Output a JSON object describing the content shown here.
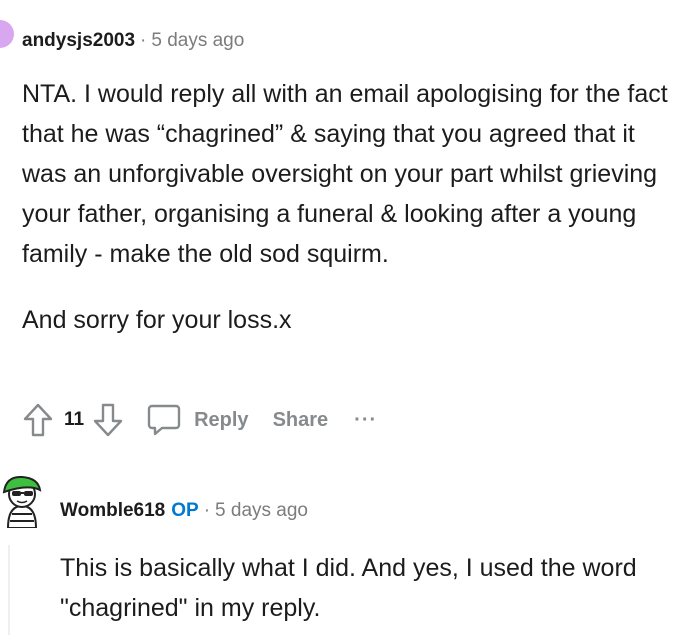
{
  "comment1": {
    "username": "andysjs2003",
    "separator": "·",
    "time": "5 days ago",
    "paragraphs": [
      "NTA. I would reply all with an email apologising for the fact that he was “chagrined” & saying that you agreed that it was an unforgivable oversight on your part whilst grieving your father, organising a funeral & looking after a young family - make the old sod squirm.",
      "And sorry for your loss.x"
    ],
    "actions": {
      "vote_count": "11",
      "reply_label": "Reply",
      "share_label": "Share",
      "more_label": "···"
    }
  },
  "comment2": {
    "username": "Womble618",
    "op_badge": "OP",
    "separator": "·",
    "time": "5 days ago",
    "body": "This is basically what I did. And yes, I used the word \"chagrined\" in my reply."
  },
  "colors": {
    "meta": "#7c7c7c",
    "action": "#878a8c",
    "op": "#0079d3",
    "avatar1": "#d9a6f0",
    "avatar2_hat": "#3fbf3f"
  },
  "icons": [
    "upvote-icon",
    "downvote-icon",
    "comment-icon",
    "more-icon"
  ]
}
